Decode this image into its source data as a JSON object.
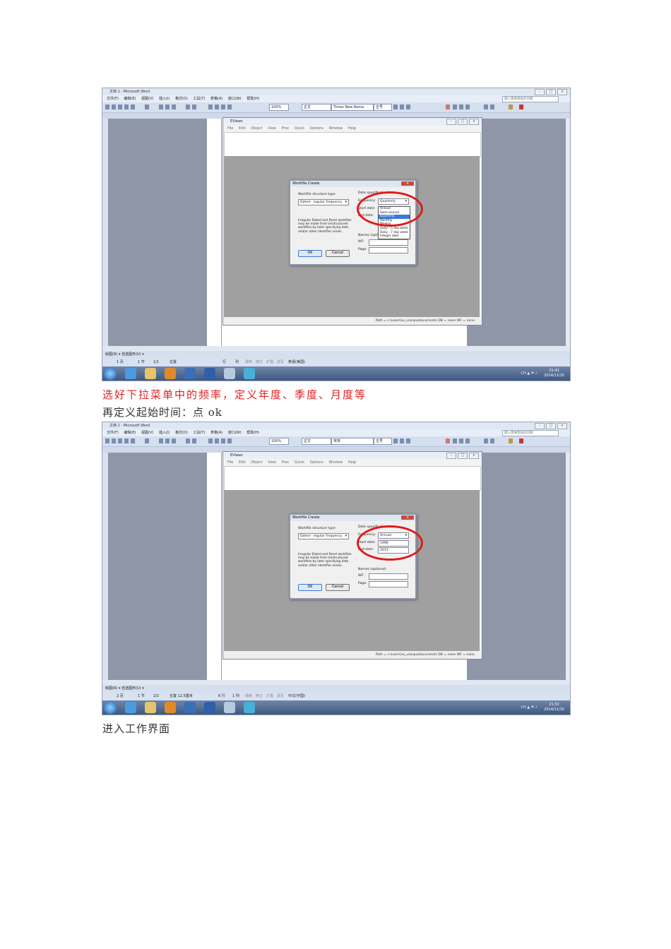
{
  "shots": [
    {
      "word_title": "文档 1 - Microsoft Word",
      "menu": [
        "文件(F)",
        "编辑(E)",
        "视图(V)",
        "插入(I)",
        "格式(O)",
        "工具(T)",
        "表格(A)",
        "窗口(W)",
        "帮助(H)"
      ],
      "help_box": "键入需要帮助的问题",
      "zoom": "100%",
      "style": "正文",
      "font": "Times New Roma",
      "font_size": "五号",
      "eviews": {
        "title": "EViews",
        "menu": [
          "File",
          "Edit",
          "Object",
          "View",
          "Proc",
          "Quick",
          "Options",
          "Window",
          "Help"
        ],
        "status": "Path = c:\\users\\xu_xianpu\\documents   DB = none   WF = none"
      },
      "dialog": {
        "title": "Workfile Create",
        "structure_label": "Workfile structure type",
        "structure_value": "Dated - regular frequency",
        "date_spec_label": "Date specification",
        "frequency_label": "Frequency:",
        "frequency_value": "Quarterly",
        "start_label": "Start date:",
        "start_value": "",
        "end_label": "End date:",
        "end_value": "",
        "dropdown_open": true,
        "dropdown_options": [
          "Annual",
          "Semi-annual",
          "Quarterly",
          "Monthly",
          "Weekly",
          "Daily - 5 day week",
          "Daily - 7 day week",
          "Integer date"
        ],
        "selected_option": "Quarterly",
        "description": "Irregular Dated and Panel workfiles may be made from Unstructured workfiles by later specifying date and/or other identifier series.",
        "names_label": "Names (optional)",
        "wf_label": "WF:",
        "page_label": "Page:",
        "ok": "OK",
        "cancel": "Cancel"
      },
      "status_items": [
        "1 页",
        "1 节",
        "1/1",
        "位置",
        "行",
        "列",
        "录制",
        "修订",
        "扩展",
        "改写",
        "英语(美国)"
      ],
      "draw_toolbar": "绘图(R) ▾  自选图形(U) ▾",
      "clock": {
        "time": "21:41",
        "date": "2014/11/10"
      }
    },
    {
      "word_title": "文档 1 - Microsoft Word",
      "menu": [
        "文件(F)",
        "编辑(E)",
        "视图(V)",
        "插入(I)",
        "格式(O)",
        "工具(T)",
        "表格(A)",
        "窗口(W)",
        "帮助(H)"
      ],
      "help_box": "键入需要帮助的问题",
      "zoom": "100%",
      "style": "正文",
      "font": "宋体",
      "font_size": "五号",
      "eviews": {
        "title": "EViews",
        "menu": [
          "File",
          "Edit",
          "Object",
          "View",
          "Proc",
          "Quick",
          "Options",
          "Window",
          "Help"
        ],
        "status": "Path = c:\\users\\xu_xianpu\\documents   DB = none   WF = none"
      },
      "dialog": {
        "title": "Workfile Create",
        "structure_label": "Workfile structure type",
        "structure_value": "Dated - regular frequency",
        "date_spec_label": "Date specification",
        "frequency_label": "Frequency:",
        "frequency_value": "Annual",
        "start_label": "Start date:",
        "start_value": "1996",
        "end_label": "End date:",
        "end_value": "2013",
        "dropdown_open": false,
        "description": "Irregular Dated and Panel workfiles may be made from Unstructured workfiles by later specifying date and/or other identifier series.",
        "names_label": "Names (optional)",
        "wf_label": "WF:",
        "page_label": "Page:",
        "ok": "OK",
        "cancel": "Cancel"
      },
      "status_items": [
        "2 页",
        "1 节",
        "2/2",
        "位置 12.5厘米",
        "6 行",
        "1 列",
        "录制",
        "修订",
        "扩展",
        "改写",
        "中文(中国)"
      ],
      "draw_toolbar": "绘图(R) ▾  自选图形(U) ▾",
      "clock": {
        "time": "21:32",
        "date": "2014/11/10"
      }
    }
  ],
  "captions": {
    "c1": "选好下拉菜单中的频率，定义年度、季度、月度等",
    "c2": "再定义起始时间：点 ok",
    "c3": "进入工作界面"
  },
  "colors": {
    "highlight_circle": "#e01a1a",
    "caption_red": "#e02020"
  }
}
